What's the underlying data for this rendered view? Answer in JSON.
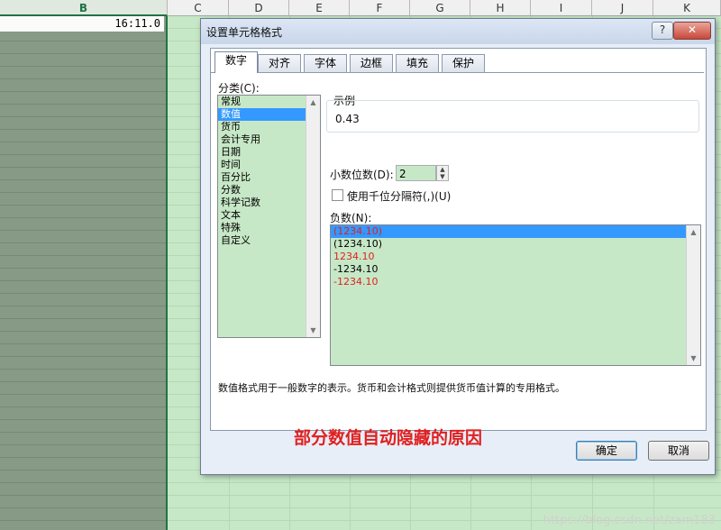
{
  "sheet": {
    "columns": [
      "B",
      "C",
      "D",
      "E",
      "F",
      "G",
      "H",
      "I",
      "J",
      "K"
    ],
    "cell_value": "16:11.0",
    "watermark": "https://blog.csdn.net/zam183"
  },
  "dialog": {
    "title": "设置单元格格式",
    "help_label": "?",
    "close_label": "✕",
    "tabs": [
      "数字",
      "对齐",
      "字体",
      "边框",
      "填充",
      "保护"
    ],
    "category_label": "分类(C):",
    "categories": [
      "常规",
      "数值",
      "货币",
      "会计专用",
      "日期",
      "时间",
      "百分比",
      "分数",
      "科学记数",
      "文本",
      "特殊",
      "自定义"
    ],
    "sample_label": "示例",
    "sample_value": "0.43",
    "decimal_label": "小数位数(D):",
    "decimal_value": "2",
    "thousands_label": "使用千位分隔符(,)(U)",
    "negative_label": "负数(N):",
    "negative_options": [
      "(1234.10)",
      "(1234.10)",
      "1234.10",
      "-1234.10",
      "-1234.10"
    ],
    "description": "数值格式用于一般数字的表示。货币和会计格式则提供货币值计算的专用格式。",
    "annotation": "部分数值自动隐藏的原因",
    "ok_label": "确定",
    "cancel_label": "取消"
  },
  "colors": {
    "sheet_green": "#c7e8c7",
    "selection_blue": "#3399ff",
    "negative_red": "#e02020"
  }
}
